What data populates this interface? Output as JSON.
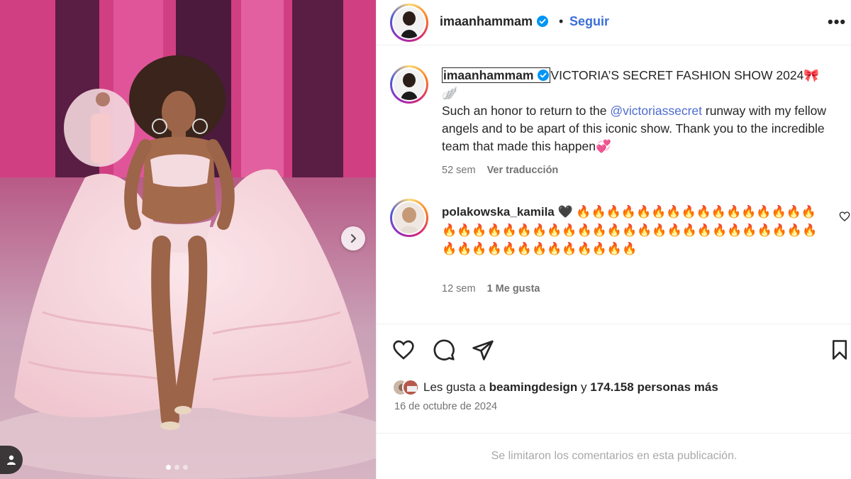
{
  "post_media": {
    "image_description_icon": "runway-photo",
    "next_icon": "chevron-right-icon",
    "carousel": {
      "count": 3,
      "active_index": 0
    },
    "tag_icon": "user-tag-icon"
  },
  "header": {
    "username": "imaanhammam",
    "separator": "•",
    "follow_label": "Seguir",
    "more_label": "•••"
  },
  "caption": {
    "username": "imaanhammam",
    "title": "VICTORIA’S SECRET FASHION SHOW 2024🎀",
    "wing_emoji": "🪽",
    "text_before_mention": "Such an honor to return to the ",
    "mention": "@victoriassecret",
    "text_after_mention": " runway with my fellow angels and to be apart of this iconic show. Thank you to the incredible team that made this happen💞",
    "time": "52 sem",
    "translate_label": "Ver traducción"
  },
  "comment": {
    "username": "polakowska_kamila",
    "text": "🖤 🔥🔥🔥🔥🔥🔥🔥🔥🔥🔥🔥🔥🔥🔥🔥🔥🔥🔥🔥🔥🔥🔥🔥🔥🔥🔥🔥🔥🔥🔥🔥🔥🔥🔥🔥🔥🔥🔥🔥🔥🔥🔥🔥🔥🔥🔥🔥🔥🔥🔥🔥🔥🔥🔥",
    "time": "12 sem",
    "likes": "1 Me gusta"
  },
  "likes": {
    "prefix": "Les gusta a ",
    "user": "beamingdesign",
    "connector": " y ",
    "count_text": "174.158 personas más"
  },
  "date": "16 de octubre de 2024",
  "comments_limited": "Se limitaron los comentarios en esta publicación.",
  "colors": {
    "link": "#4d6bcf",
    "verified": "#0095f6",
    "muted": "#737373",
    "text": "#262626"
  }
}
